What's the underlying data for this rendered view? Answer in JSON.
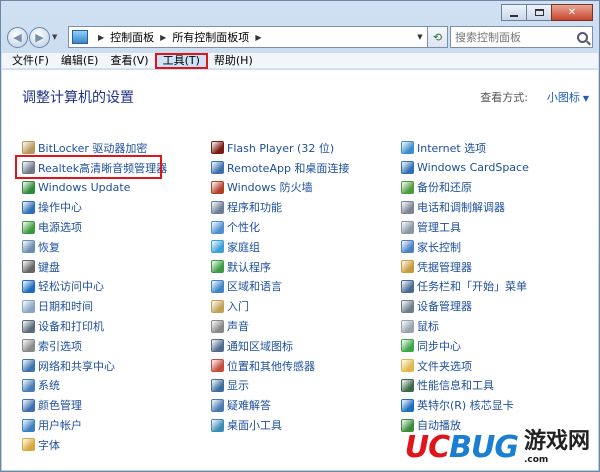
{
  "window": {
    "controls": {
      "minimize": "",
      "maximize": "",
      "close": "✕"
    }
  },
  "address": {
    "crumbs": [
      "控制面板",
      "所有控制面板项"
    ],
    "search_placeholder": "搜索控制面板"
  },
  "menubar": {
    "items": [
      "文件(F)",
      "编辑(E)",
      "查看(V)",
      "工具(T)",
      "帮助(H)"
    ],
    "active": "工具(T)"
  },
  "content": {
    "title": "调整计算机的设置",
    "view_by_label": "查看方式:",
    "view_by_value": "小图标",
    "columns": [
      [
        {
          "label": "BitLocker 驱动器加密",
          "icon": "bitlocker-icon",
          "color": "#b9985a"
        },
        {
          "label": "Realtek高清晰音频管理器",
          "icon": "realtek-audio-icon",
          "color": "#6f7b8a"
        },
        {
          "label": "Windows Update",
          "icon": "windows-update-icon",
          "color": "#2d8a36"
        },
        {
          "label": "操作中心",
          "icon": "action-center-flag-icon",
          "color": "#2f6fb8"
        },
        {
          "label": "电源选项",
          "icon": "power-options-icon",
          "color": "#3e9a3e"
        },
        {
          "label": "恢复",
          "icon": "recovery-icon",
          "color": "#6c8fb0"
        },
        {
          "label": "键盘",
          "icon": "keyboard-icon",
          "color": "#666666"
        },
        {
          "label": "轻松访问中心",
          "icon": "ease-of-access-icon",
          "color": "#1f6dbf"
        },
        {
          "label": "日期和时间",
          "icon": "date-time-icon",
          "color": "#8aa6c4"
        },
        {
          "label": "设备和打印机",
          "icon": "devices-printers-icon",
          "color": "#5b6b7c"
        },
        {
          "label": "索引选项",
          "icon": "indexing-icon",
          "color": "#8a8a8a"
        },
        {
          "label": "网络和共享中心",
          "icon": "network-sharing-icon",
          "color": "#3d73b0"
        },
        {
          "label": "系统",
          "icon": "system-icon",
          "color": "#4a7db8"
        },
        {
          "label": "颜色管理",
          "icon": "color-management-icon",
          "color": "#3e6fb0"
        },
        {
          "label": "用户帐户",
          "icon": "user-accounts-icon",
          "color": "#3b7fc4"
        },
        {
          "label": "字体",
          "icon": "fonts-icon",
          "color": "#d9a83a"
        }
      ],
      [
        {
          "label": "Flash Player (32 位)",
          "icon": "flash-player-icon",
          "color": "#7a1a12"
        },
        {
          "label": "RemoteApp 和桌面连接",
          "icon": "remoteapp-icon",
          "color": "#3b6fae"
        },
        {
          "label": "Windows 防火墙",
          "icon": "firewall-icon",
          "color": "#b3412a"
        },
        {
          "label": "程序和功能",
          "icon": "programs-features-icon",
          "color": "#6b7f99"
        },
        {
          "label": "个性化",
          "icon": "personalization-icon",
          "color": "#4d8fd1"
        },
        {
          "label": "家庭组",
          "icon": "homegroup-icon",
          "color": "#3aa0d8"
        },
        {
          "label": "默认程序",
          "icon": "default-programs-icon",
          "color": "#3c9b43"
        },
        {
          "label": "区域和语言",
          "icon": "region-language-icon",
          "color": "#3f84c8"
        },
        {
          "label": "入门",
          "icon": "getting-started-icon",
          "color": "#c3a255"
        },
        {
          "label": "声音",
          "icon": "sound-icon",
          "color": "#888888"
        },
        {
          "label": "通知区域图标",
          "icon": "notification-area-icon",
          "color": "#4f6c8e"
        },
        {
          "label": "位置和其他传感器",
          "icon": "location-sensors-icon",
          "color": "#c44d3c"
        },
        {
          "label": "显示",
          "icon": "display-icon",
          "color": "#3d6e9e"
        },
        {
          "label": "疑难解答",
          "icon": "troubleshooting-icon",
          "color": "#4b79ad"
        },
        {
          "label": "桌面小工具",
          "icon": "desktop-gadgets-icon",
          "color": "#3a8bb5"
        }
      ],
      [
        {
          "label": "Internet 选项",
          "icon": "internet-options-icon",
          "color": "#3c8dd0"
        },
        {
          "label": "Windows CardSpace",
          "icon": "cardspace-icon",
          "color": "#2f6fb8"
        },
        {
          "label": "备份和还原",
          "icon": "backup-restore-icon",
          "color": "#4e9b3d"
        },
        {
          "label": "电话和调制解调器",
          "icon": "phone-modem-icon",
          "color": "#7a8593"
        },
        {
          "label": "管理工具",
          "icon": "admin-tools-icon",
          "color": "#8a96a6"
        },
        {
          "label": "家长控制",
          "icon": "parental-controls-icon",
          "color": "#4c82c5"
        },
        {
          "label": "凭据管理器",
          "icon": "credential-manager-icon",
          "color": "#c79a3b"
        },
        {
          "label": "任务栏和「开始」菜单",
          "icon": "taskbar-start-icon",
          "color": "#4a6a93"
        },
        {
          "label": "设备管理器",
          "icon": "device-manager-icon",
          "color": "#6e7d8d"
        },
        {
          "label": "鼠标",
          "icon": "mouse-icon",
          "color": "#9aa3ad"
        },
        {
          "label": "同步中心",
          "icon": "sync-center-icon",
          "color": "#3ea64a"
        },
        {
          "label": "文件夹选项",
          "icon": "folder-options-icon",
          "color": "#e0b94a"
        },
        {
          "label": "性能信息和工具",
          "icon": "performance-icon",
          "color": "#3d6b4a"
        },
        {
          "label": "英特尔(R) 核芯显卡",
          "icon": "intel-graphics-icon",
          "color": "#1f6fc0"
        },
        {
          "label": "自动播放",
          "icon": "autoplay-icon",
          "color": "#3b8c3b"
        }
      ]
    ]
  },
  "watermark": {
    "logo_red": "UC",
    "logo_blue": "BUG",
    "title": "游戏网",
    "url": ".com"
  }
}
